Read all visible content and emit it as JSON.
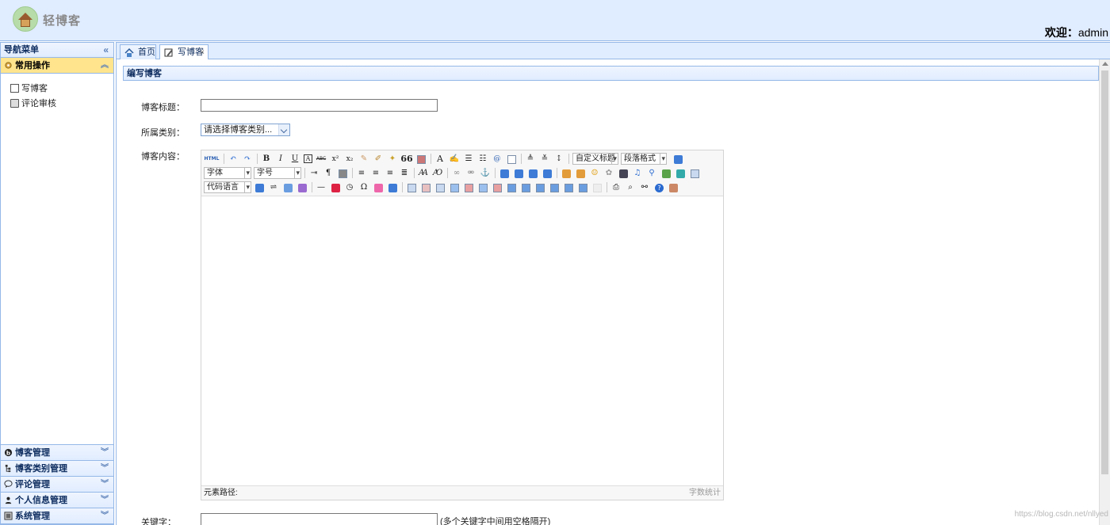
{
  "header": {
    "logo_text": "轻博客",
    "welcome_label": "欢迎：",
    "username": "admin"
  },
  "sidebar": {
    "title": "导航菜单",
    "collapse_icon": "double-chevron-left-icon",
    "active_section": "常用操作",
    "active_items": [
      {
        "label": "写博客",
        "icon": "edit-icon"
      },
      {
        "label": "评论审核",
        "icon": "comment-review-icon"
      }
    ],
    "sections": [
      {
        "label": "博客管理",
        "icon": "blog-icon"
      },
      {
        "label": "博客类别管理",
        "icon": "category-icon"
      },
      {
        "label": "评论管理",
        "icon": "comment-icon"
      },
      {
        "label": "个人信息管理",
        "icon": "user-icon"
      },
      {
        "label": "系统管理",
        "icon": "system-icon"
      }
    ]
  },
  "tabs": [
    {
      "label": "首页",
      "icon": "home-icon",
      "active": false
    },
    {
      "label": "写博客",
      "icon": "edit-icon",
      "active": true,
      "closable": true,
      "close_glyph": "×"
    }
  ],
  "panel": {
    "title": "编写博客"
  },
  "form": {
    "title_label": "博客标题：",
    "title_value": "",
    "category_label": "所属类别：",
    "category_selected": "请选择博客类别...",
    "content_label": "博客内容：",
    "keywords_label": "关键字：",
    "keywords_value": "",
    "keywords_hint": "(多个关键字中间用空格隔开)"
  },
  "editor": {
    "combo_custom_title": "自定义标题",
    "combo_paragraph": "段落格式",
    "combo_font": "字体",
    "combo_size": "字号",
    "combo_code": "代码语言",
    "footer_path": "元素路径:",
    "footer_count": "字数统计",
    "row1_text_buttons": [
      "HTML",
      "B",
      "I",
      "U",
      "A",
      "ABC",
      "x²",
      "x₂",
      "66",
      "A",
      "@"
    ],
    "row3_text_buttons": [
      "—",
      "Ω",
      "?"
    ]
  },
  "watermark": "https://blog.csdn.net/nllyed"
}
